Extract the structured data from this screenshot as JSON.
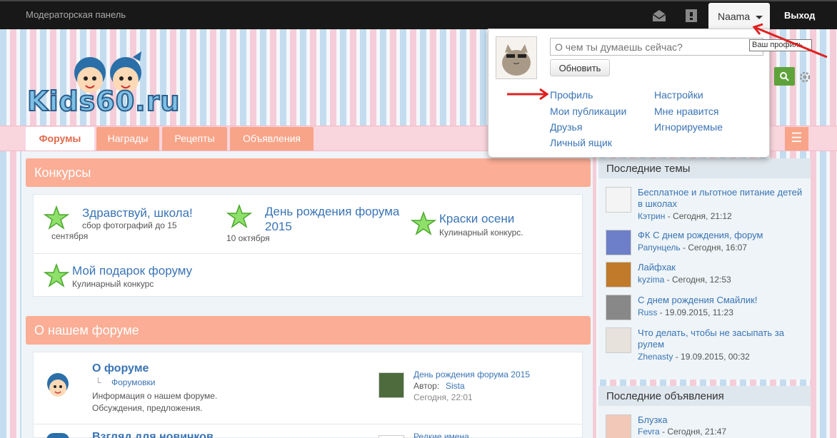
{
  "topbar": {
    "moderator_panel": "Модераторская панель",
    "username": "Naama",
    "logout": "Выход"
  },
  "logo": {
    "text": "Kids60.ru"
  },
  "nav": {
    "tabs": [
      "Форумы",
      "Награды",
      "Рецепты",
      "Объявления"
    ],
    "active": 0
  },
  "contests_panel": {
    "title": "Конкурсы",
    "items": [
      {
        "title": "Здравствуй, школа!",
        "sub": "сбор фотографий до 15",
        "date": "сентября"
      },
      {
        "title": "День рождения форума 2015",
        "sub": "",
        "date": "10 октября"
      },
      {
        "title": "Краски осени",
        "sub": "Кулинарный конкурс.",
        "date": ""
      },
      {
        "title": "Мой подарок форуму",
        "sub": "Кулинарный конкурс",
        "date": ""
      }
    ]
  },
  "about_panel": {
    "title": "О нашем форуме",
    "forum": {
      "title": "О форуме",
      "subforum": "Форумовки",
      "desc1": "Информация о нашем форуме.",
      "desc2": "Обсуждения, предложения.",
      "last_title": "День рождения форума 2015",
      "author_label": "Автор:",
      "author": "Sista",
      "time": "Сегодня, 22:01"
    },
    "forum2": {
      "title": "Взгляд для новичков",
      "last_title": "Редкие имена"
    }
  },
  "sidebar": {
    "latest_threads": {
      "title": "Последние темы",
      "items": [
        {
          "title": "Бесплатное и льготное питание детей в школах",
          "user": "Кэтрин",
          "time": "Сегодня, 21:12"
        },
        {
          "title": "ФК С днем рождения, форум",
          "user": "Рапунцель",
          "time": "Сегодня, 16:07"
        },
        {
          "title": "Лайфхак",
          "user": "kyzima",
          "time": "Сегодня, 12:53"
        },
        {
          "title": "С днем рождения Смайлик!",
          "user": "Russ",
          "time": "19.09.2015, 11:23"
        },
        {
          "title": "Что делать, чтобы не засыпать за рулем",
          "user": "Zhenasty",
          "time": "19.09.2015, 00:32"
        }
      ]
    },
    "latest_ads": {
      "title": "Последние объявления",
      "items": [
        {
          "title": "Блузка",
          "user": "Fevra",
          "time": "Сегодня, 21:47"
        }
      ]
    }
  },
  "dropdown": {
    "placeholder": "О чем ты думаешь сейчас?",
    "update": "Обновить",
    "links_left": [
      "Профиль",
      "Мои публикации",
      "Друзья",
      "Личный ящик"
    ],
    "links_right": [
      "Настройки",
      "Мне нравится",
      "Игнорируемые"
    ],
    "tooltip": "Ваш профиль"
  },
  "colors": {
    "accent": "#f8a489",
    "link": "#3a74b5",
    "topbar": "#181818"
  }
}
